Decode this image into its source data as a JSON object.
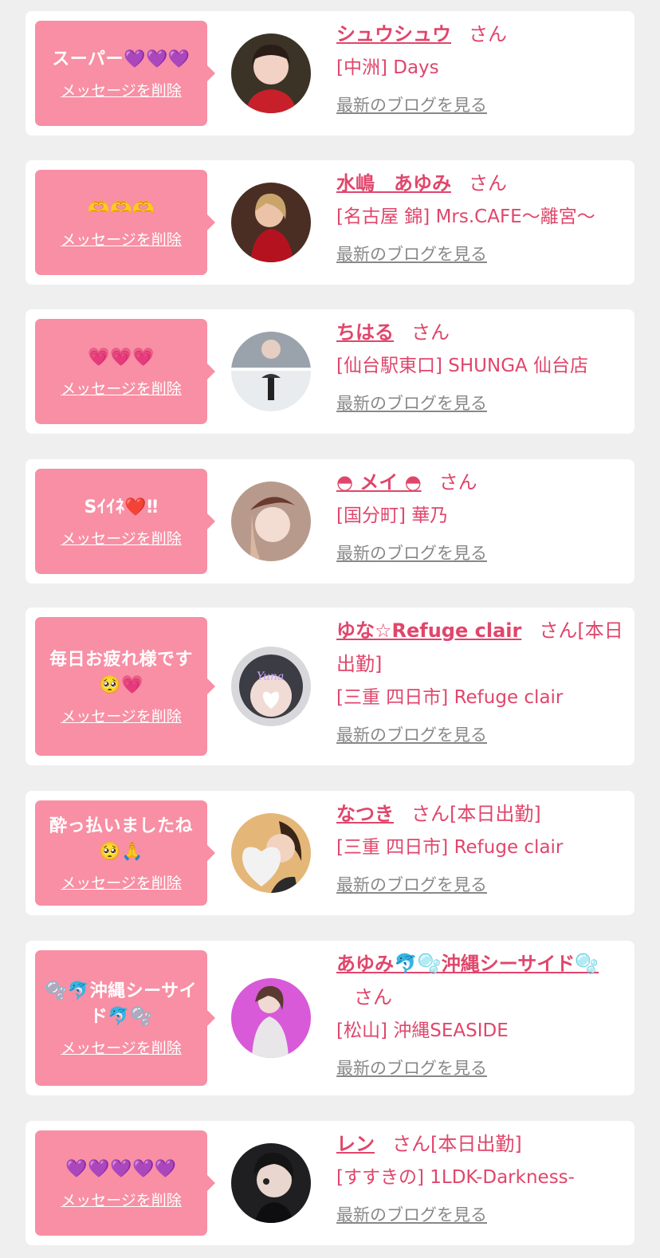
{
  "colors": {
    "accent": "#e0466b",
    "bubble": "#f88fa4",
    "link_gray": "#888888",
    "background": "#efefef"
  },
  "common": {
    "delete_label": "メッセージを削除",
    "san_label": "さん",
    "blog_label": "最新のブログを見る"
  },
  "items": [
    {
      "message": "スーパー💜💜💜",
      "name": "シュウシュウ",
      "extra": "",
      "shop": "[中洲] Days",
      "avatar_icon": "avatar-woman-red-top"
    },
    {
      "message": "🫶🫶🫶",
      "name": "水嶋　あゆみ",
      "extra": "",
      "shop": "[名古屋 錦] Mrs.CAFE〜離宮〜",
      "avatar_icon": "avatar-woman-red-dress"
    },
    {
      "message": "💗💗💗",
      "name": "ちはる",
      "extra": "",
      "shop": "[仙台駅東口] SHUNGA 仙台店",
      "avatar_icon": "avatar-snow-scene"
    },
    {
      "message": "Sｲｲﾈ❤️‼︎",
      "name": "◓ メイ ◓",
      "extra": "",
      "shop": "[国分町] 華乃",
      "avatar_icon": "avatar-woman-hat"
    },
    {
      "message": "毎日お疲れ様です🥺💗",
      "name": "ゆな☆Refuge clair",
      "extra": "[本日出勤]",
      "shop": "[三重 四日市] Refuge clair",
      "avatar_icon": "avatar-yuna-heart"
    },
    {
      "message": "酔っ払いましたね🥺🙏",
      "name": "なつき",
      "extra": "[本日出勤]",
      "shop": "[三重 四日市] Refuge clair",
      "avatar_icon": "avatar-woman-heart"
    },
    {
      "message": "🫧🐬沖縄シーサイド🐬🫧",
      "name": "あゆみ🐬🫧沖縄シーサイド🫧",
      "extra": "",
      "shop": "[松山] 沖縄SEASIDE",
      "avatar_icon": "avatar-woman-purple"
    },
    {
      "message": "💜💜💜💜💜",
      "name": "レン",
      "extra": "[本日出勤]",
      "shop": "[すすきの] 1LDK-Darkness-",
      "avatar_icon": "avatar-woman-dark"
    }
  ]
}
